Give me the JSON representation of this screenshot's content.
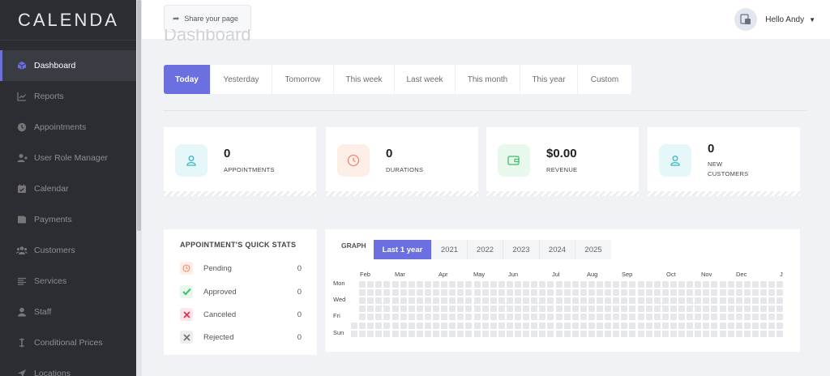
{
  "sidebar": {
    "logo": "CALENDA",
    "items": [
      {
        "label": "Dashboard",
        "icon": "cube-icon",
        "active": true
      },
      {
        "label": "Reports",
        "icon": "chart-icon"
      },
      {
        "label": "Appointments",
        "icon": "clock-icon"
      },
      {
        "label": "User Role Manager",
        "icon": "user-plus-icon"
      },
      {
        "label": "Calendar",
        "icon": "calendar-icon"
      },
      {
        "label": "Payments",
        "icon": "wallet-icon"
      },
      {
        "label": "Customers",
        "icon": "users-icon"
      },
      {
        "label": "Services",
        "icon": "list-icon"
      },
      {
        "label": "Staff",
        "icon": "person-icon"
      },
      {
        "label": "Conditional Prices",
        "icon": "dollar-icon"
      },
      {
        "label": "Locations",
        "icon": "location-arrow-icon"
      }
    ]
  },
  "header": {
    "share_label": "Share your page",
    "greeting": "Hello Andy"
  },
  "page_title": "Dashboard",
  "date_tabs": [
    "Today",
    "Yesterday",
    "Tomorrow",
    "This week",
    "Last week",
    "This month",
    "This year",
    "Custom"
  ],
  "stats": [
    {
      "value": "0",
      "label": "APPOINTMENTS",
      "icon": "user-icon",
      "icon_color": "#3cb8c8",
      "bg": "#e6f7fa"
    },
    {
      "value": "0",
      "label": "DURATIONS",
      "icon": "clock-icon",
      "icon_color": "#ef8a6a",
      "bg": "#fdeee8"
    },
    {
      "value": "$0.00",
      "label": "REVENUE",
      "icon": "wallet-icon",
      "icon_color": "#3fbf6a",
      "bg": "#e8f8ed"
    },
    {
      "value": "0",
      "label": "NEW CUSTOMERS",
      "icon": "user-icon",
      "icon_color": "#3cb8c8",
      "bg": "#e6f7fa"
    }
  ],
  "quick_stats": {
    "title": "APPOINTMENT'S QUICK STATS",
    "rows": [
      {
        "label": "Pending",
        "value": "0",
        "icon": "clock-icon",
        "color": "#ef8a6a",
        "bg": "#fdeee8"
      },
      {
        "label": "Approved",
        "value": "0",
        "icon": "check-icon",
        "color": "#3fbf6a",
        "bg": "#e8f8ed"
      },
      {
        "label": "Canceled",
        "value": "0",
        "icon": "x-icon",
        "color": "#e0324e",
        "bg": "#fde6ea"
      },
      {
        "label": "Rejected",
        "value": "0",
        "icon": "x-icon",
        "color": "#777777",
        "bg": "#eeeeee"
      }
    ]
  },
  "graph": {
    "label": "GRAPH",
    "tabs": [
      "Last 1 year",
      "2021",
      "2022",
      "2023",
      "2024",
      "2025"
    ],
    "months": [
      "Feb",
      "Mar",
      "Apr",
      "May",
      "Jun",
      "Jul",
      "Aug",
      "Sep",
      "Oct",
      "Nov",
      "Dec",
      "J"
    ],
    "days": [
      "Mon",
      "Wed",
      "Fri",
      "Sun"
    ]
  },
  "colors": {
    "accent": "#6b6fe0",
    "sidebar": "#2b2d33"
  }
}
